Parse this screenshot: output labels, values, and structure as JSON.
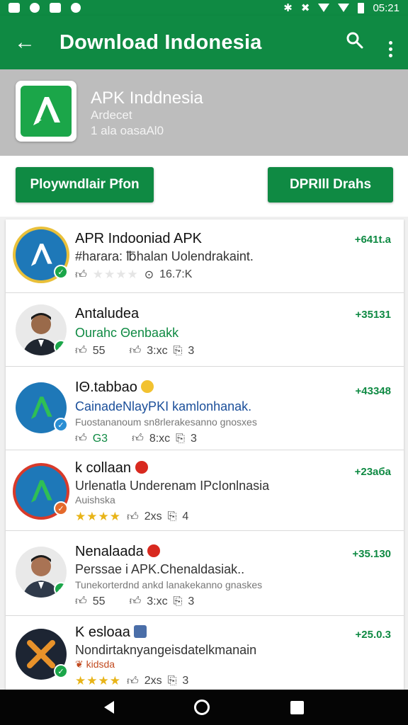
{
  "status_bar": {
    "time": "05:21",
    "icons": [
      "image-icon",
      "record-icon",
      "app-icon",
      "sync-icon",
      "bluetooth-icon",
      "vibrate-icon",
      "wifi-icon",
      "signal-icon",
      "battery-icon"
    ]
  },
  "appbar": {
    "title": "Download Indonesia",
    "back_icon": "arrow-back-icon",
    "search_icon": "search-icon",
    "menu_icon": "more-vert-icon"
  },
  "header": {
    "title": "APK Inddnesia",
    "subtitle": "Ardecet",
    "meta": "1 ala oasaAl0"
  },
  "actions": {
    "primary": "Ploywndlair Pfon",
    "secondary": "DPRIll Drahs"
  },
  "colors": {
    "primary": "#0f8a43",
    "accent": "#1ba649",
    "star": "#e8b418"
  },
  "rows": [
    {
      "title": "APR Indooniad APK",
      "line": "#harara: ℔halan Uolendrakaint.",
      "count": "+641t.a",
      "stat1": "",
      "stat2": "16.7:K",
      "rating": 0
    },
    {
      "title": "Antaludea",
      "line": "Ourahc Θenbaakk",
      "count": "+35131",
      "stat1": "55",
      "stat2": "3:xc",
      "stat3": "3"
    },
    {
      "title": "IΘ.tabbao",
      "line": "CainadeNlayPKI kamlonhanak.",
      "small": "Fuostananoum sn8rlerakesanno gnosxes",
      "count": "+43348",
      "stat1": "G3",
      "stat2": "8:xc",
      "stat3": "3"
    },
    {
      "title": "k collaan",
      "line": "Urlenatla Underenam IPcIonlnasia",
      "small": "Auishska",
      "count": "+23аба",
      "rating": 4,
      "stat2": "2xs",
      "stat3": "4"
    },
    {
      "title": "Nenalaada",
      "line": "Perssae i APK.Chenaldasiak..",
      "small": "Tunekorterdnd ankd lanakekanno gnaskes",
      "count": "+35.130",
      "stat1": "55",
      "stat2": "3:xc",
      "stat3": "3"
    },
    {
      "title": "K esloaa",
      "line": "Nondirtaknyangeisdatelkmanain",
      "small": "❦ kidsda",
      "count": "+25.0.3",
      "rating": 4,
      "stat2": "2xs",
      "stat3": "3"
    }
  ],
  "navbar": {
    "back": "nav-back-icon",
    "home": "nav-home-icon",
    "recents": "nav-recents-icon"
  }
}
